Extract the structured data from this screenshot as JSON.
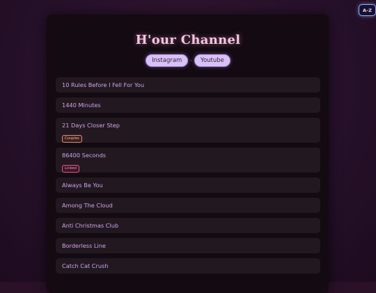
{
  "sort_button": {
    "label": "A–Z"
  },
  "header": {
    "title": "H'our Channel",
    "links": [
      {
        "label": "Instagram"
      },
      {
        "label": "Youtube"
      }
    ],
    "separator": "·"
  },
  "items": [
    {
      "title": "10 Rules Before I Fell For You"
    },
    {
      "title": "1440 Minutes"
    },
    {
      "title": "21 Days Closer Step",
      "tag": "Couples"
    },
    {
      "title": "86400 Seconds",
      "tag": "Linked"
    },
    {
      "title": "Always Be You"
    },
    {
      "title": "Among The Cloud"
    },
    {
      "title": "Anti Christmas Club"
    },
    {
      "title": "Borderless Line"
    },
    {
      "title": "Catch Cat Crush"
    }
  ],
  "colors": {
    "accent": "#cfa2ea",
    "title": "#f3c6e0",
    "pill_bg": "#d8c2f4",
    "tag_couples": "#e08c7c",
    "tag_linked": "#e85a86"
  }
}
